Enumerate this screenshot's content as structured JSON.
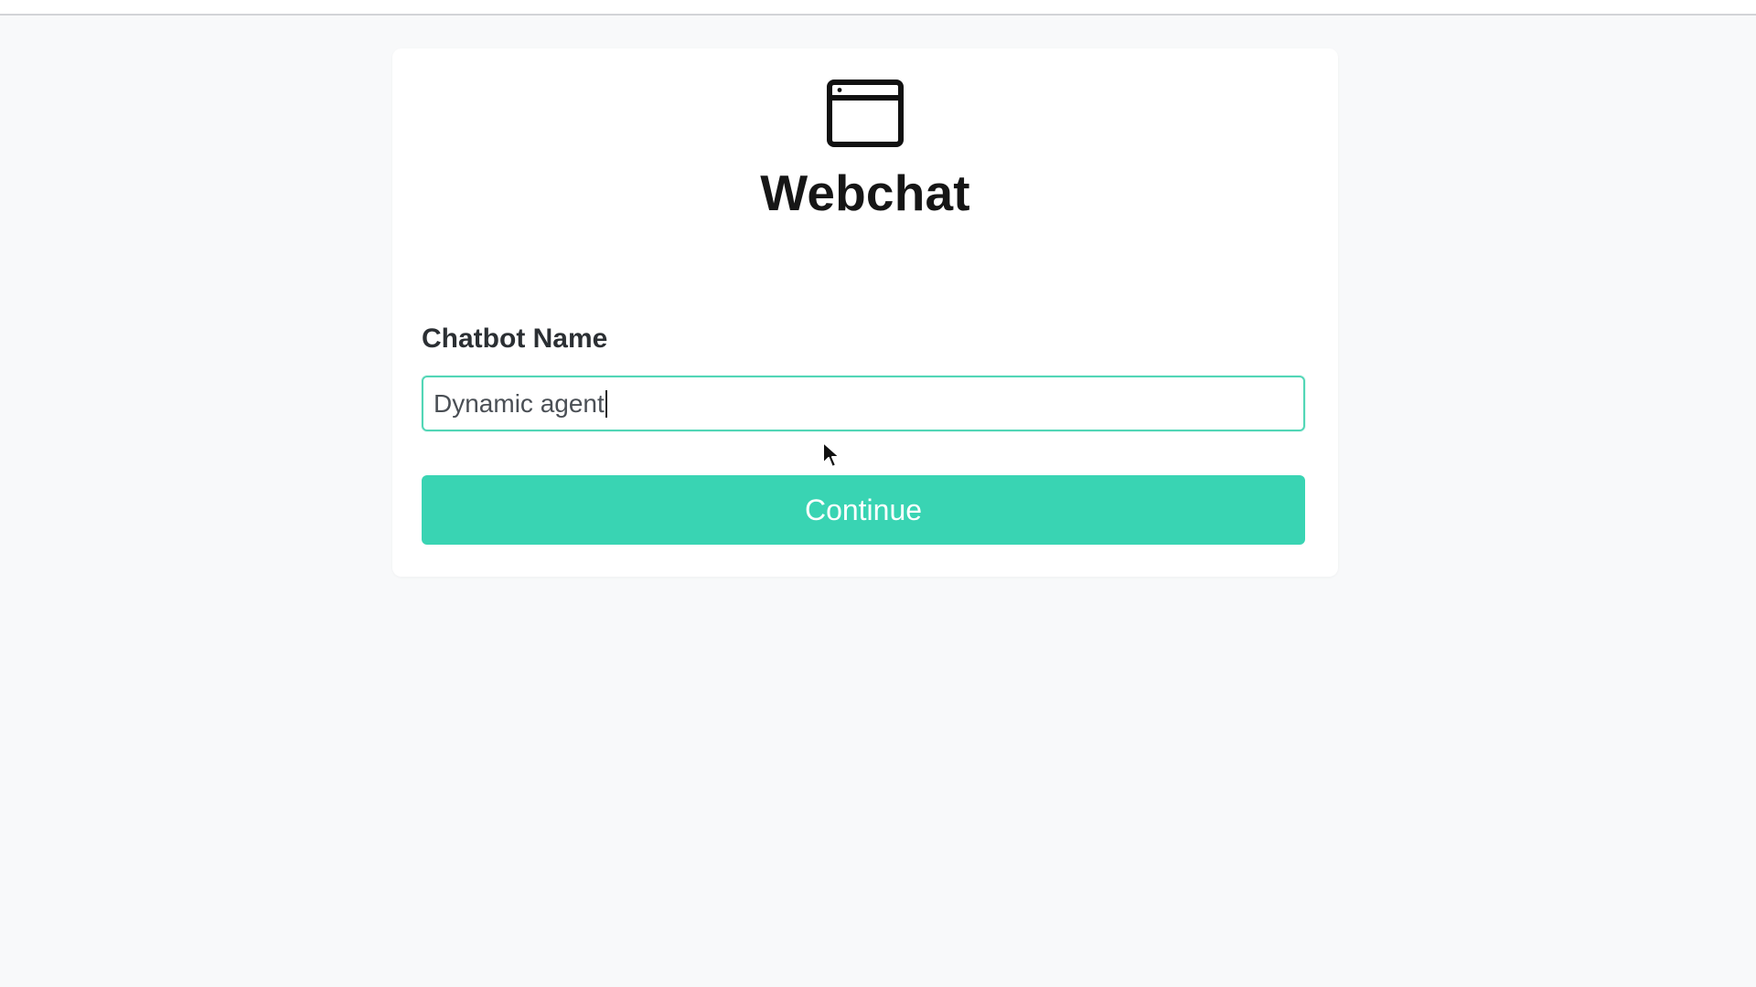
{
  "app": {
    "title": "Webchat",
    "header_icon": "browser-window-icon"
  },
  "form": {
    "label": "Chatbot Name",
    "input_value": "Dynamic agent",
    "button_label": "Continue"
  },
  "colors": {
    "accent": "#39d4b3",
    "input_border": "#52d6b6",
    "background": "#f8f9fa",
    "card": "#ffffff",
    "title_text": "#161616"
  }
}
